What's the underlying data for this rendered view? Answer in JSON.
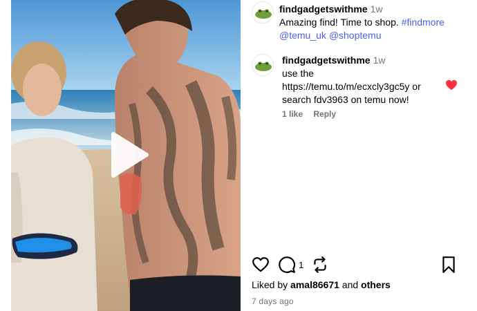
{
  "post": {
    "caption": {
      "username": "findgadgetswithme",
      "time": "1w",
      "text": "Amazing find! Time to shop.",
      "hashtag": "#findmore",
      "mention_1": "@temu_uk",
      "mention_2": "@shoptemu"
    },
    "comments": [
      {
        "username": "findgadgetswithme",
        "time": "1w",
        "line_1": "use the",
        "line_2": "https://temu.to/m/ecxcly3gc5y or",
        "line_3": "search fdv3963 on temu now!",
        "likes_label": "1 like",
        "reply_label": "Reply",
        "liked": true,
        "heart_color": "#ff3040"
      }
    ],
    "actions": {
      "comment_count": "1"
    },
    "liked_by": {
      "prefix": "Liked by",
      "user": "amal86671",
      "connector": "and",
      "others": "others"
    },
    "age": "7 days ago"
  },
  "icons": {
    "play": "play-icon",
    "like": "heart-outline-icon",
    "comment": "comment-bubble-icon",
    "share": "repost-icon",
    "save": "bookmark-icon",
    "comment_like": "heart-filled-icon"
  },
  "colors": {
    "link": "#4a5ff0",
    "muted": "#737373",
    "like_red": "#ff3040"
  }
}
